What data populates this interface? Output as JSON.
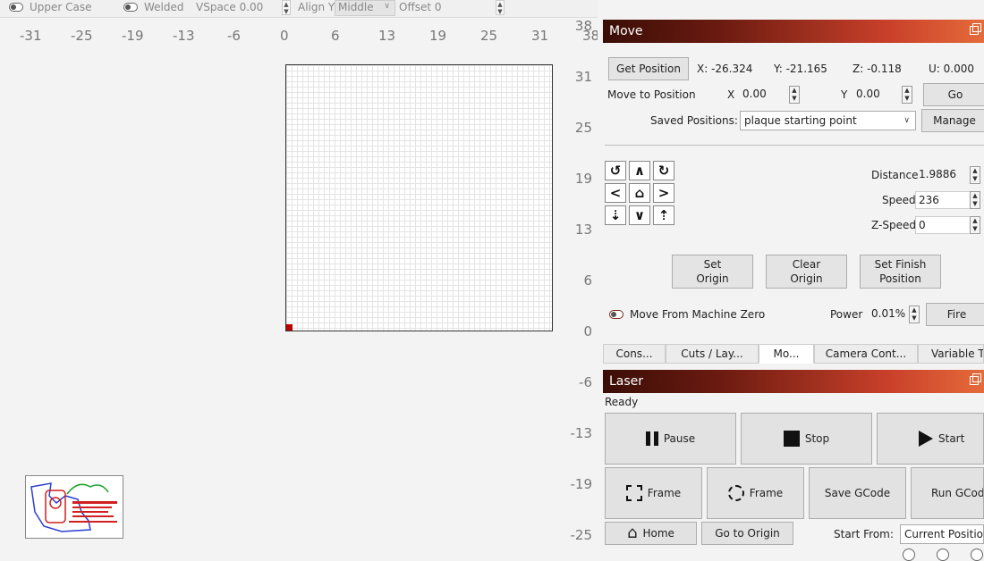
{
  "toolbar": {
    "upper_case_label": "Upper Case",
    "welded_label": "Welded",
    "vspace_label": "VSpace 0.00",
    "align_y_label": "Align Y",
    "align_y_value": "Middle",
    "offset_label": "Offset 0"
  },
  "rulers": {
    "x_ticks": [
      "-31",
      "-25",
      "-19",
      "-13",
      "-6",
      "0",
      "6",
      "13",
      "19",
      "25",
      "31",
      "38"
    ],
    "y_ticks": [
      "38",
      "31",
      "25",
      "19",
      "13",
      "6",
      "0",
      "-6",
      "-13",
      "-19",
      "-25"
    ]
  },
  "move_panel": {
    "title": "Move",
    "get_position_label": "Get Position",
    "pos_x": "X: -26.324",
    "pos_y": "Y: -21.165",
    "pos_z": "Z: -0.118",
    "pos_u": "U: 0.000",
    "move_to_position_label": "Move to Position",
    "x_label": "X",
    "x_value": "0.00",
    "y_label": "Y",
    "y_value": "0.00",
    "go_label": "Go",
    "saved_positions_label": "Saved Positions:",
    "saved_positions_value": "plaque starting point",
    "manage_label": "Manage",
    "distance_label": "Distance",
    "distance_value": "1.9886",
    "speed_label": "Speed",
    "speed_value": "236",
    "zspeed_label": "Z-Speed",
    "zspeed_value": "0",
    "set_origin_label": "Set Origin",
    "clear_origin_label": "Clear Origin",
    "set_finish_label": "Set Finish Position",
    "move_from_zero_label": "Move From Machine Zero",
    "power_label": "Power",
    "power_value": "0.01%",
    "fire_label": "Fire"
  },
  "tabs": [
    {
      "label": "Cons..."
    },
    {
      "label": "Cuts / Lay..."
    },
    {
      "label": "Mo..."
    },
    {
      "label": "Camera Cont..."
    },
    {
      "label": "Variable T"
    }
  ],
  "laser_panel": {
    "title": "Laser",
    "status": "Ready",
    "pause_label": "Pause",
    "stop_label": "Stop",
    "start_label": "Start",
    "frame1_label": "Frame",
    "frame2_label": "Frame",
    "save_gcode_label": "Save GCode",
    "run_gcode_label": "Run GCode",
    "home_label": "Home",
    "go_to_origin_label": "Go to Origin",
    "start_from_label": "Start From:",
    "start_from_value": "Current Position"
  },
  "colors": {
    "title_gradient_start": "#3a0e06",
    "title_gradient_end": "#e56b3a",
    "origin_marker": "#bb0000"
  }
}
